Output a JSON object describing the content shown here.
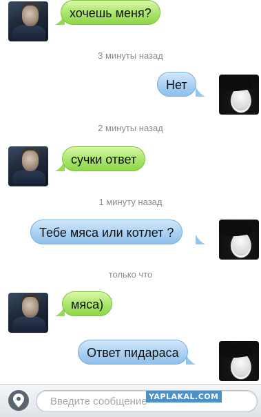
{
  "messages": [
    {
      "from": "him",
      "text": "хочешь меня?"
    },
    {
      "from": "her",
      "text": "Нет"
    },
    {
      "from": "him",
      "text": "сучки ответ"
    },
    {
      "from": "her",
      "text": "Тебе мяса или котлет ?"
    },
    {
      "from": "him",
      "text": "мяса)"
    },
    {
      "from": "her",
      "text": "Ответ пидараса"
    }
  ],
  "timestamps": [
    "3 минуты назад",
    "2 минуты назад",
    "1 минуту назад",
    "только что"
  ],
  "input": {
    "placeholder": "Введите сообщение",
    "value": ""
  },
  "watermark": "YAPLAKAL.COM",
  "icons": {
    "location": "location-pin-icon"
  },
  "colors": {
    "incoming_bubble": "#a8e56a",
    "outgoing_bubble": "#a9d0f2",
    "timestamp_text": "#8a8a8a",
    "watermark_bg": "#4c90c8"
  }
}
